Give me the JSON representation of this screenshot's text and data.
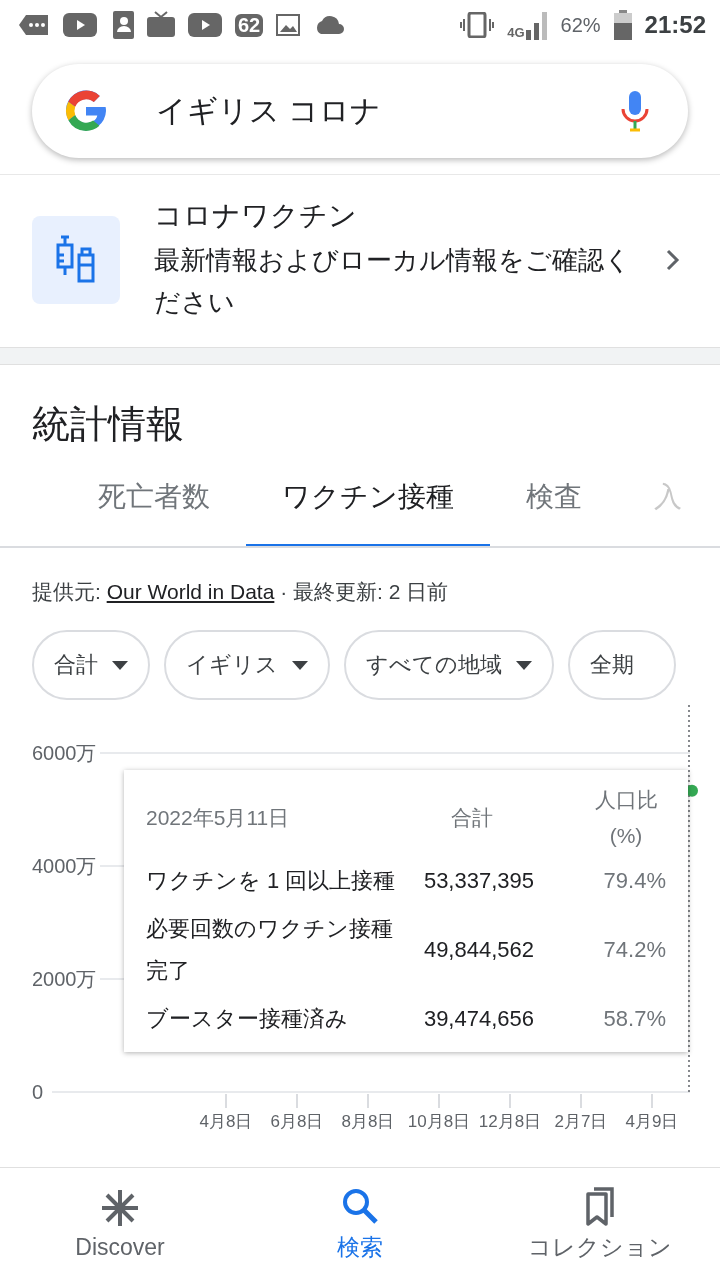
{
  "status_bar": {
    "notification_badge": "62",
    "network": "4G",
    "battery": "62%",
    "time": "21:52"
  },
  "search": {
    "value": "イギリス コロナ"
  },
  "vaccine_card": {
    "title": "コロナワクチン",
    "subtitle": "最新情報およびローカル情報をご確認ください"
  },
  "stats": {
    "heading": "統計情報",
    "tabs": [
      {
        "label": "死亡者数",
        "selected": false
      },
      {
        "label": "ワクチン接種",
        "selected": true
      },
      {
        "label": "検査",
        "selected": false
      },
      {
        "label": "入",
        "selected": false
      }
    ],
    "source": {
      "prefix": "提供元:",
      "link": "Our World in Data",
      "suffix": "· 最終更新: 2 日前"
    },
    "filters": [
      {
        "label": "合計"
      },
      {
        "label": "イギリス"
      },
      {
        "label": "すべての地域"
      },
      {
        "label": "全期"
      }
    ],
    "chart_data": {
      "type": "line",
      "categories": [
        "4月8日",
        "6月8日",
        "8月8日",
        "10月8日",
        "12月8日",
        "2月7日",
        "4月9日"
      ],
      "ylim": [
        0,
        6000
      ],
      "yticks": [
        {
          "value": 0,
          "label": "0"
        },
        {
          "value": 2000,
          "label": "2000万"
        },
        {
          "value": 4000,
          "label": "4000万"
        },
        {
          "value": 6000,
          "label": "6000万"
        }
      ]
    },
    "tooltip": {
      "date": "2022年5月11日",
      "columns": [
        "合計",
        "人口比 (%)"
      ],
      "rows": [
        {
          "label": "ワクチンを 1 回以上接種",
          "total": "53,337,395",
          "percent": "79.4%"
        },
        {
          "label": "必要回数のワクチン接種完了",
          "total": "49,844,562",
          "percent": "74.2%"
        },
        {
          "label": "ブースター接種済み",
          "total": "39,474,656",
          "percent": "58.7%"
        }
      ]
    }
  },
  "bottom_nav": [
    {
      "label": "Discover",
      "selected": false
    },
    {
      "label": "検索",
      "selected": true
    },
    {
      "label": "コレクション",
      "selected": false
    }
  ]
}
